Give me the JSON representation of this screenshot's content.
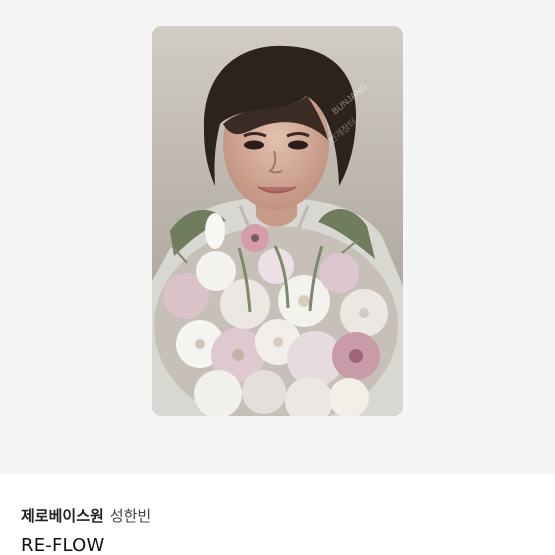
{
  "product": {
    "artist": "제로베이스원",
    "member": "성한빈",
    "album": "RE-FLOW"
  },
  "photocard": {
    "icon": "photocard-image",
    "colors": {
      "background": "#b9b4ad",
      "hair": "#2d221e",
      "skin": "#d8b19f",
      "flowers_white": "#f4f2ef",
      "flowers_pink": "#c99aa7",
      "leaves": "#6f7d5d"
    }
  },
  "colors": {
    "image_area_background": "#f5f5f5",
    "text_primary": "#111111",
    "text_secondary": "#444444"
  }
}
